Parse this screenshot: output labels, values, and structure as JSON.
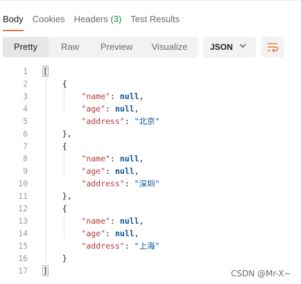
{
  "tabs": [
    {
      "label": "Body",
      "active": true
    },
    {
      "label": "Cookies",
      "active": false
    },
    {
      "label": "Headers",
      "count": "(3)",
      "active": false
    },
    {
      "label": "Test Results",
      "active": false
    }
  ],
  "view_modes": [
    "Pretty",
    "Raw",
    "Preview",
    "Visualize"
  ],
  "active_view": "Pretty",
  "format": "JSON",
  "icons": {
    "format_dropdown": "chevron-down-icon",
    "wrap": "wrap-lines-icon"
  },
  "colors": {
    "accent": "#e8743b",
    "count": "#0d8c3d",
    "key": "#b33a3a",
    "value": "#0b5394"
  },
  "json_lines": [
    {
      "n": "1",
      "text": "["
    },
    {
      "n": "2",
      "text": "    {"
    },
    {
      "n": "3",
      "key": "\"name\"",
      "value": "null",
      "value_type": "null"
    },
    {
      "n": "4",
      "key": "\"age\"",
      "value": "null",
      "value_type": "null"
    },
    {
      "n": "5",
      "key": "\"address\"",
      "value": "\"北京\"",
      "value_type": "string"
    },
    {
      "n": "6",
      "text": "    },"
    },
    {
      "n": "7",
      "text": "    {"
    },
    {
      "n": "8",
      "key": "\"name\"",
      "value": "null",
      "value_type": "null"
    },
    {
      "n": "9",
      "key": "\"age\"",
      "value": "null",
      "value_type": "null"
    },
    {
      "n": "10",
      "key": "\"address\"",
      "value": "\"深圳\"",
      "value_type": "string"
    },
    {
      "n": "11",
      "text": "    },"
    },
    {
      "n": "12",
      "text": "    {"
    },
    {
      "n": "13",
      "key": "\"name\"",
      "value": "null",
      "value_type": "null"
    },
    {
      "n": "14",
      "key": "\"age\"",
      "value": "null",
      "value_type": "null"
    },
    {
      "n": "15",
      "key": "\"address\"",
      "value": "\"上海\"",
      "value_type": "string"
    },
    {
      "n": "16",
      "text": "    }"
    },
    {
      "n": "17",
      "text": "]"
    }
  ],
  "watermark": "CSDN @Mr-X~"
}
